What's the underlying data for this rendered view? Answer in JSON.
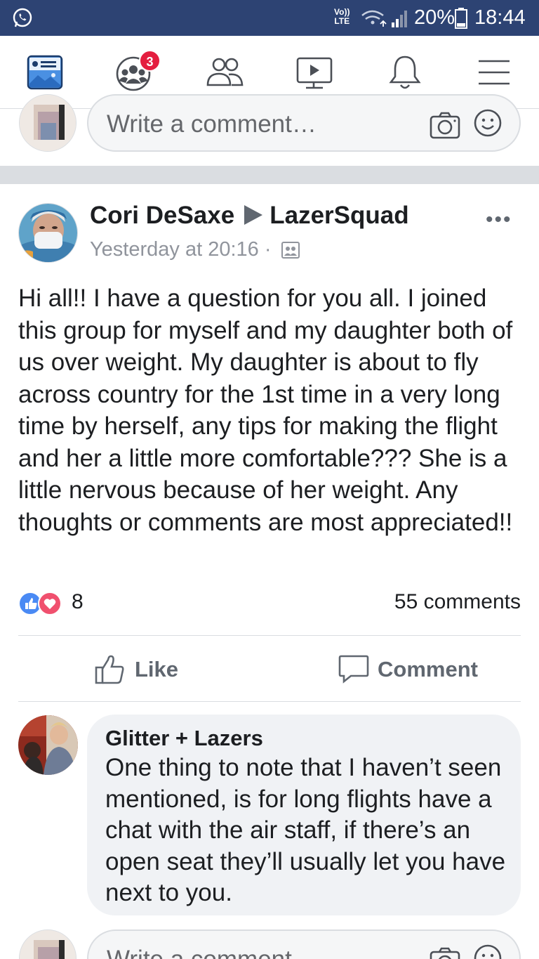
{
  "status_bar": {
    "network_label_top": "Vo))",
    "network_label_bottom": "LTE",
    "battery_percent": "20%",
    "time": "18:44"
  },
  "nav": {
    "groups_badge": "3",
    "icons": [
      "news-feed-icon",
      "groups-icon",
      "friends-icon",
      "watch-icon",
      "notifications-icon",
      "menu-icon"
    ]
  },
  "composer_top": {
    "placeholder": "Write a comment…"
  },
  "post": {
    "author": "Cori DeSaxe",
    "group": "LazerSquad",
    "timestamp": "Yesterday at 20:16 ·",
    "text": "Hi all!! I have a question for you all. I joined this group for myself and my daughter both of us over weight. My daughter is about to fly across country for the 1st time in a very long time by herself, any tips for making the flight and her a little more comfortable??? She is a little nervous because of her weight. Any thoughts or comments are most appreciated!!",
    "reaction_count": "8",
    "comments_count": "55 comments",
    "like_label": "Like",
    "comment_label": "Comment"
  },
  "comment": {
    "author": "Glitter + Lazers",
    "text": "One thing to note that I haven’t seen mentioned, is for long flights have a chat with the air staff, if there’s an open seat they’ll usually let you have next to you."
  },
  "composer_bottom": {
    "placeholder": "Write a comment…"
  },
  "colors": {
    "status_bar": "#2d4373",
    "like_blue": "#4a8af4",
    "love_red": "#f0506e",
    "badge_red": "#e41e3f"
  }
}
